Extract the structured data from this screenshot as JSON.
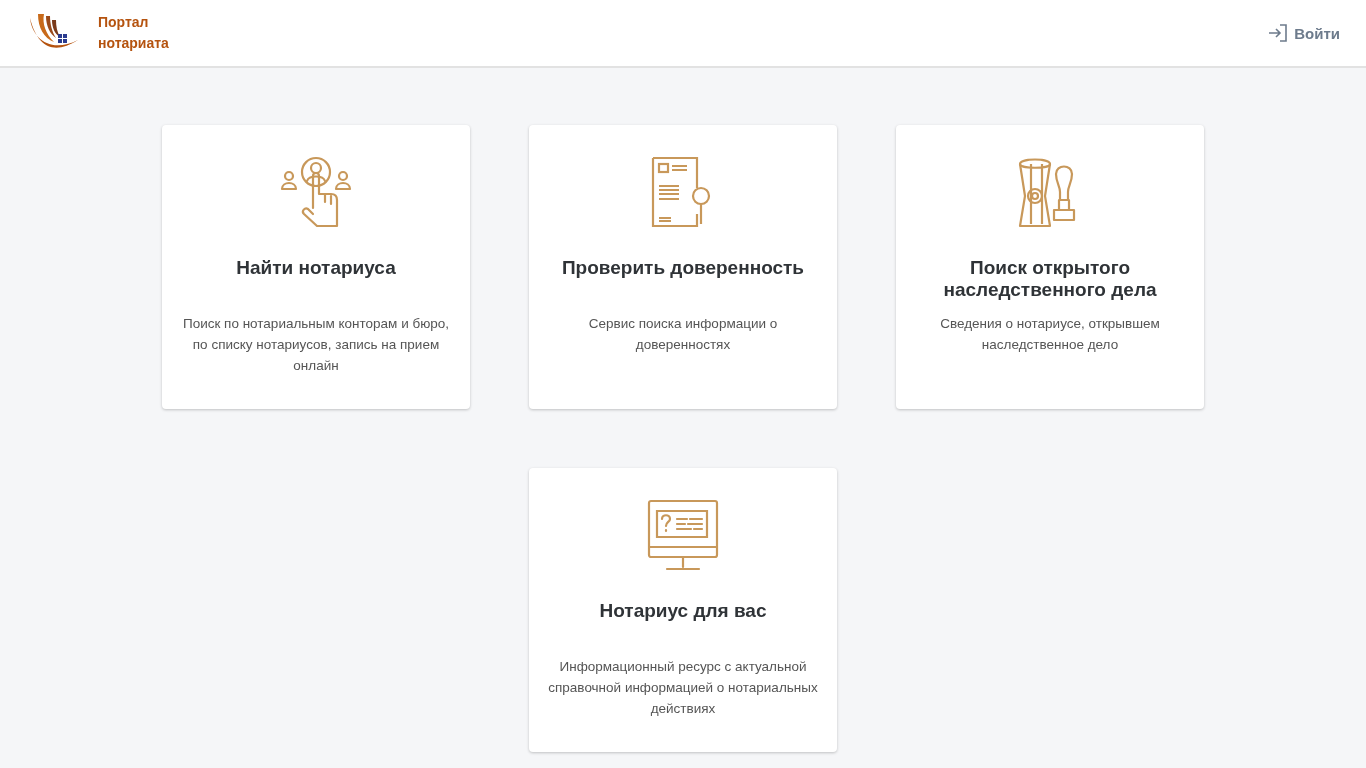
{
  "header": {
    "logo_text": "Портал нотариата",
    "login": "Войти"
  },
  "cards": [
    {
      "kind": "find",
      "title": "Найти нотариуса",
      "description": "Поиск по нотариальным конторам и бюро, по списку нотариусов, запись на прием онлайн"
    },
    {
      "kind": "check",
      "title": "Проверить доверенность",
      "description": "Сервис поиска информации о доверенностях"
    },
    {
      "kind": "inherit",
      "title": "Поиск открытого наследственного дела",
      "description": "Сведения о нотариусе, открывшем наследственное дело"
    },
    {
      "kind": "info",
      "title": "Нотариус для вас",
      "description": "Информационный ресурс с актуальной справочной информацией о нотариальных действиях"
    }
  ]
}
